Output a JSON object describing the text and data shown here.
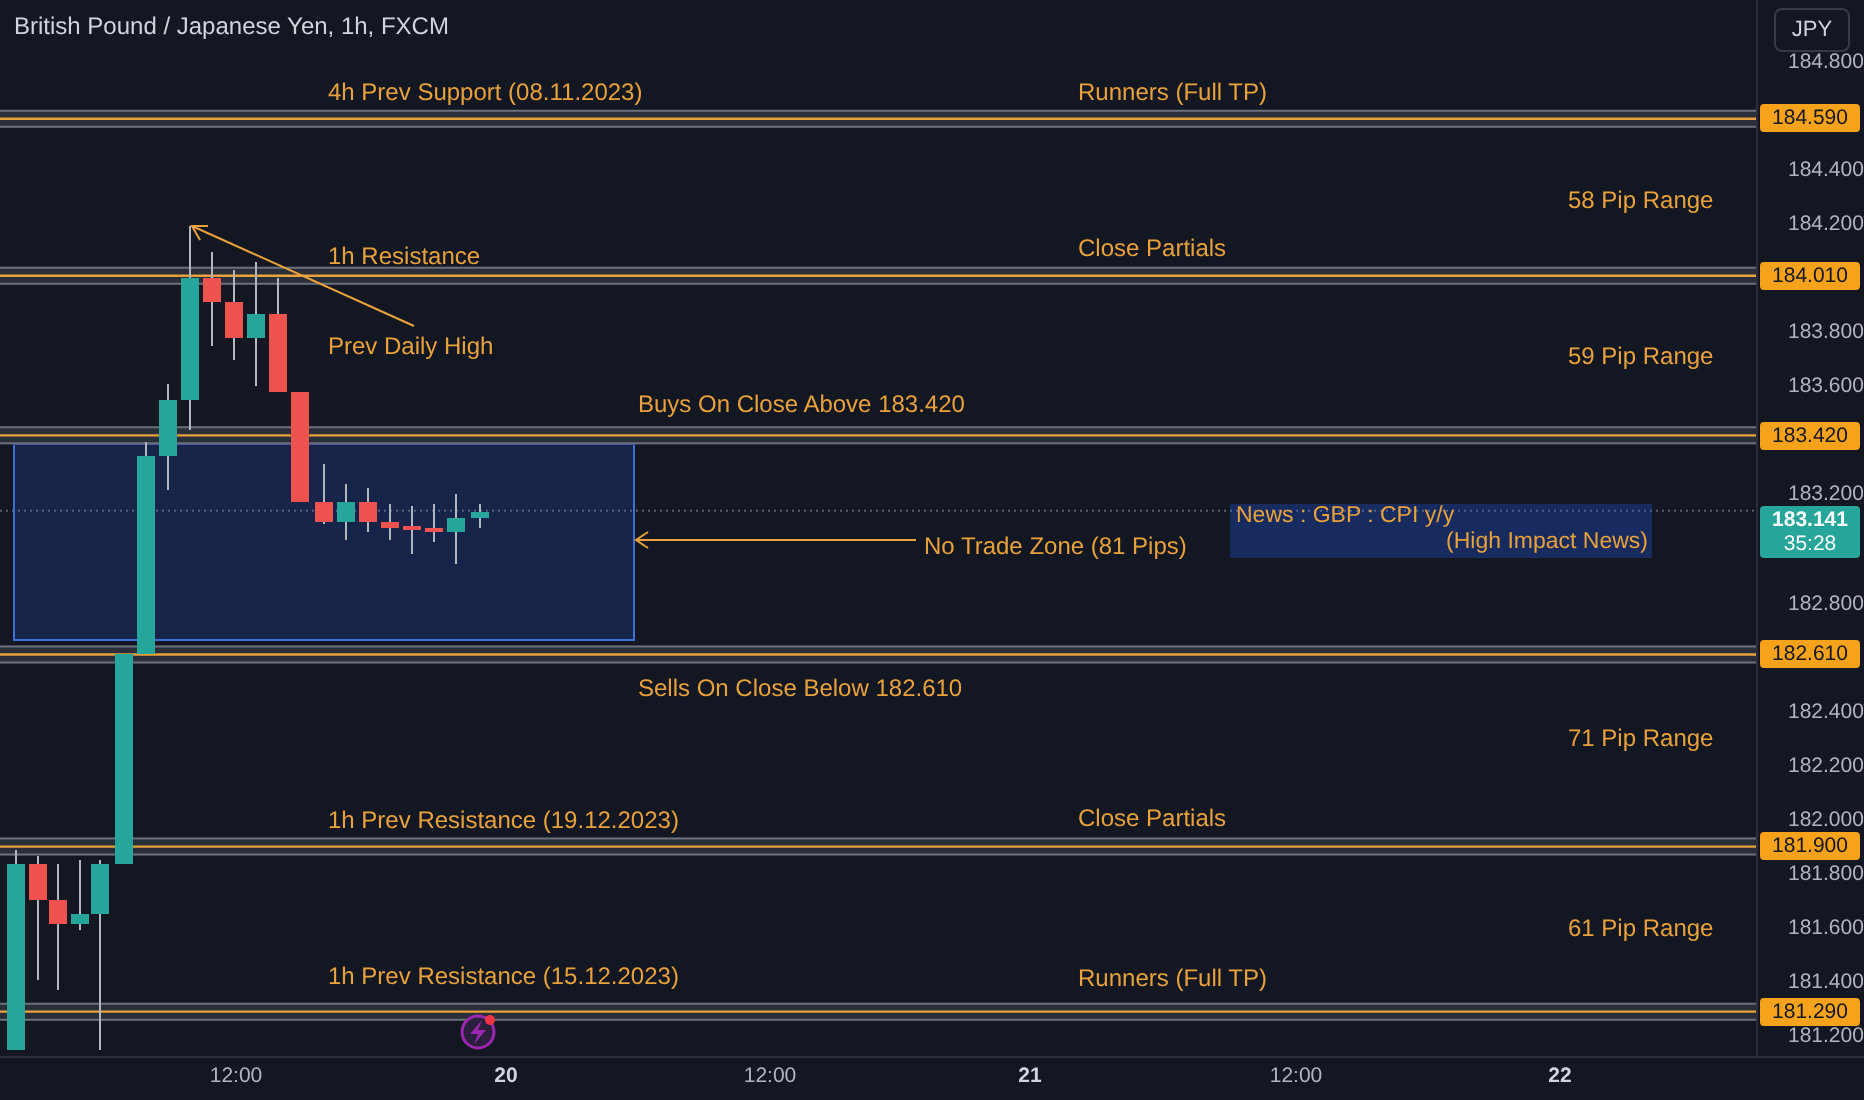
{
  "header": {
    "title": "British Pound / Japanese Yen, 1h, FXCM"
  },
  "currency_button": {
    "label": "JPY"
  },
  "price_axis": {
    "ticks": [
      "184.800",
      "184.400",
      "184.200",
      "183.800",
      "183.600",
      "183.200",
      "182.800",
      "182.400",
      "182.200",
      "182.000",
      "181.800",
      "181.600",
      "181.400",
      "181.200"
    ]
  },
  "levels": [
    {
      "price": "184.590"
    },
    {
      "price": "184.010"
    },
    {
      "price": "183.420"
    },
    {
      "price": "182.610"
    },
    {
      "price": "181.900"
    },
    {
      "price": "181.290"
    }
  ],
  "current_price": {
    "price": "183.141",
    "countdown": "35:28"
  },
  "time_axis": [
    {
      "label": "12:00",
      "kind": "time"
    },
    {
      "label": "20",
      "kind": "day"
    },
    {
      "label": "12:00",
      "kind": "time"
    },
    {
      "label": "21",
      "kind": "day"
    },
    {
      "label": "12:00",
      "kind": "time"
    },
    {
      "label": "22",
      "kind": "day"
    }
  ],
  "annotations": [
    {
      "text": "4h Prev Support (08.11.2023)"
    },
    {
      "text": "Runners (Full TP)"
    },
    {
      "text": "58 Pip Range"
    },
    {
      "text": "1h Resistance"
    },
    {
      "text": "Close Partials"
    },
    {
      "text": "Prev Daily High"
    },
    {
      "text": "59 Pip Range"
    },
    {
      "text": "Buys On Close Above 183.420"
    },
    {
      "text": "Sells On Close Below 182.610"
    },
    {
      "text": "71 Pip Range"
    },
    {
      "text": "1h Prev Resistance (19.12.2023)"
    },
    {
      "text": "Close Partials"
    },
    {
      "text": "61 Pip Range"
    },
    {
      "text": "1h Prev Resistance (15.12.2023)"
    },
    {
      "text": "Runners (Full TP)"
    }
  ],
  "zone": {
    "label": "No Trade Zone (81 Pips)"
  },
  "news": {
    "title": "News : GBP : CPI y/y",
    "subtitle": "(High Impact News)"
  }
}
